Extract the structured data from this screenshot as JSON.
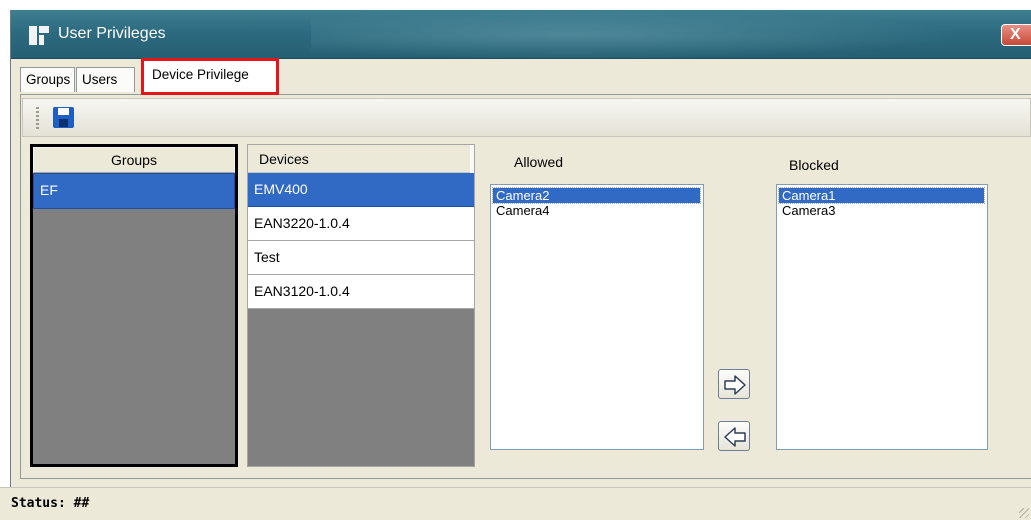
{
  "window": {
    "title": "User Privileges",
    "close_glyph": "X"
  },
  "tabs": [
    {
      "label": "Groups"
    },
    {
      "label": "Users"
    },
    {
      "label": "Device Privilege",
      "active": true
    }
  ],
  "toolbar": {
    "save_icon": "save-icon"
  },
  "groups": {
    "header": "Groups",
    "rows": [
      "EF"
    ],
    "selected": "EF"
  },
  "devices": {
    "header": "Devices",
    "rows": [
      "EMV400",
      "EAN3220-1.0.4",
      "Test",
      "EAN3120-1.0.4"
    ],
    "selected": "EMV400"
  },
  "allowed": {
    "label": "Allowed",
    "items": [
      "Camera2",
      "Camera4"
    ],
    "selected": "Camera2"
  },
  "blocked": {
    "label": "Blocked",
    "items": [
      "Camera1",
      "Camera3"
    ],
    "selected": "Camera1"
  },
  "buttons": {
    "move_right_icon": "arrow-right-icon",
    "move_left_icon": "arrow-left-icon"
  },
  "status": {
    "text": "Status: ##"
  },
  "colors": {
    "selection": "#316ac5",
    "titlebar": "#2d6b80",
    "highlight_border": "#e5151c"
  }
}
